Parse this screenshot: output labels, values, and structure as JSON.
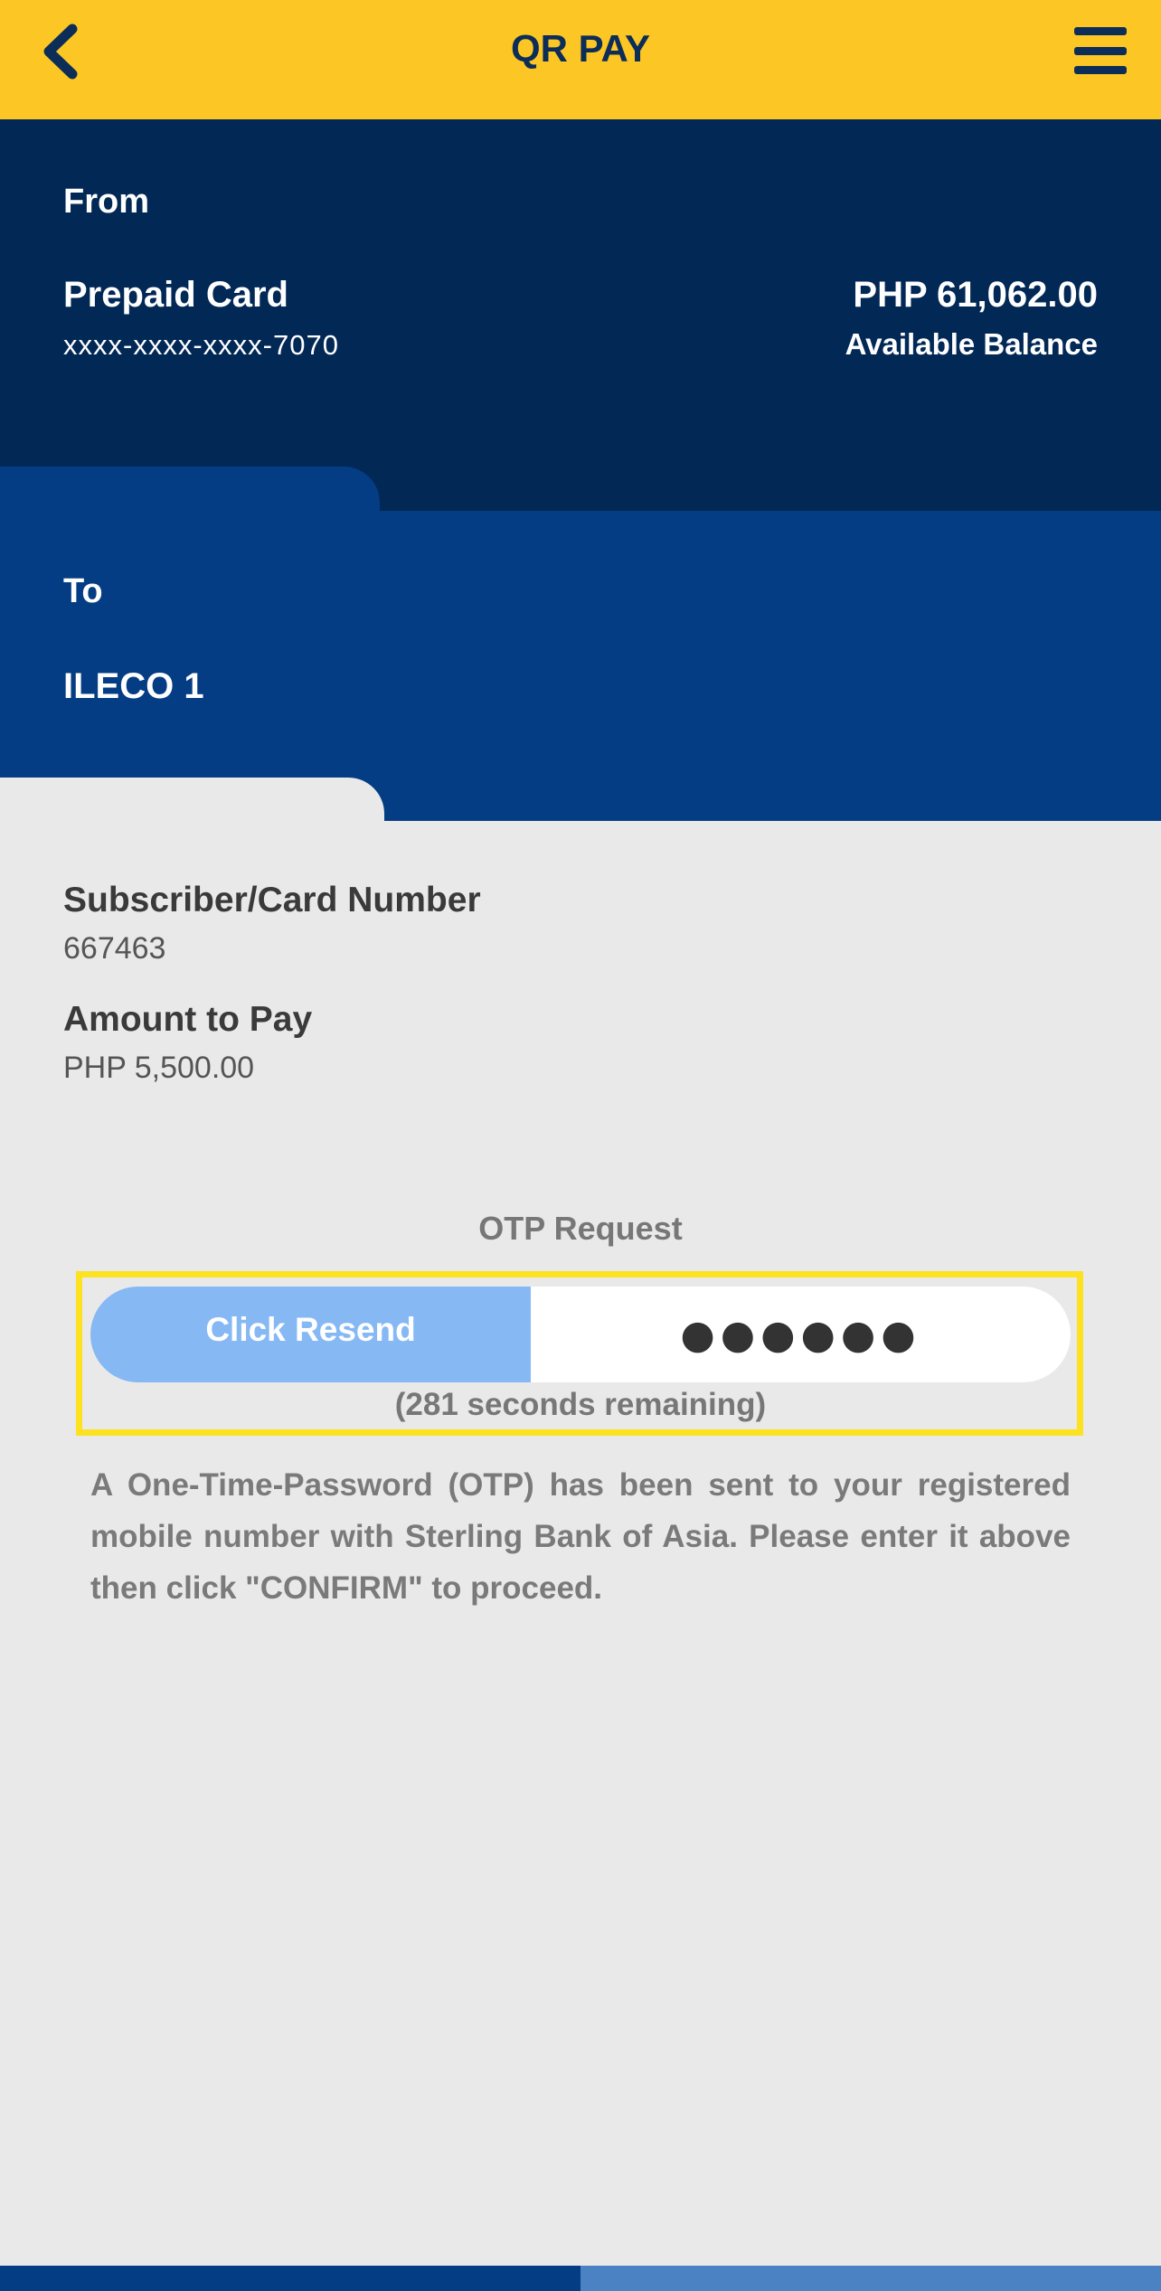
{
  "header": {
    "title": "QR PAY",
    "back_icon": "chevron-left-icon",
    "menu_icon": "hamburger-menu-icon"
  },
  "from": {
    "label": "From",
    "account_name": "Prepaid Card",
    "account_number": "xxxx-xxxx-xxxx-7070",
    "balance": "PHP 61,062.00",
    "balance_label": "Available Balance"
  },
  "to": {
    "label": "To",
    "name": "ILECO 1"
  },
  "details": {
    "subscriber_label": "Subscriber/Card Number",
    "subscriber_value": "667463",
    "amount_label": "Amount to Pay",
    "amount_value": "PHP 5,500.00"
  },
  "otp": {
    "title": "OTP Request",
    "resend_label": "Click Resend",
    "input_value": "●●●●●●",
    "timer": "(281 seconds remaining)",
    "note": "A One-Time-Password (OTP) has been sent to your registered mobile number with Sterling Bank of Asia. Please enter it above then click \"CONFIRM\" to proceed."
  },
  "colors": {
    "header_bg": "#fcc624",
    "from_bg": "#022856",
    "to_bg": "#043d84",
    "resend_bg": "#86b9f4",
    "highlight": "#fce221"
  }
}
